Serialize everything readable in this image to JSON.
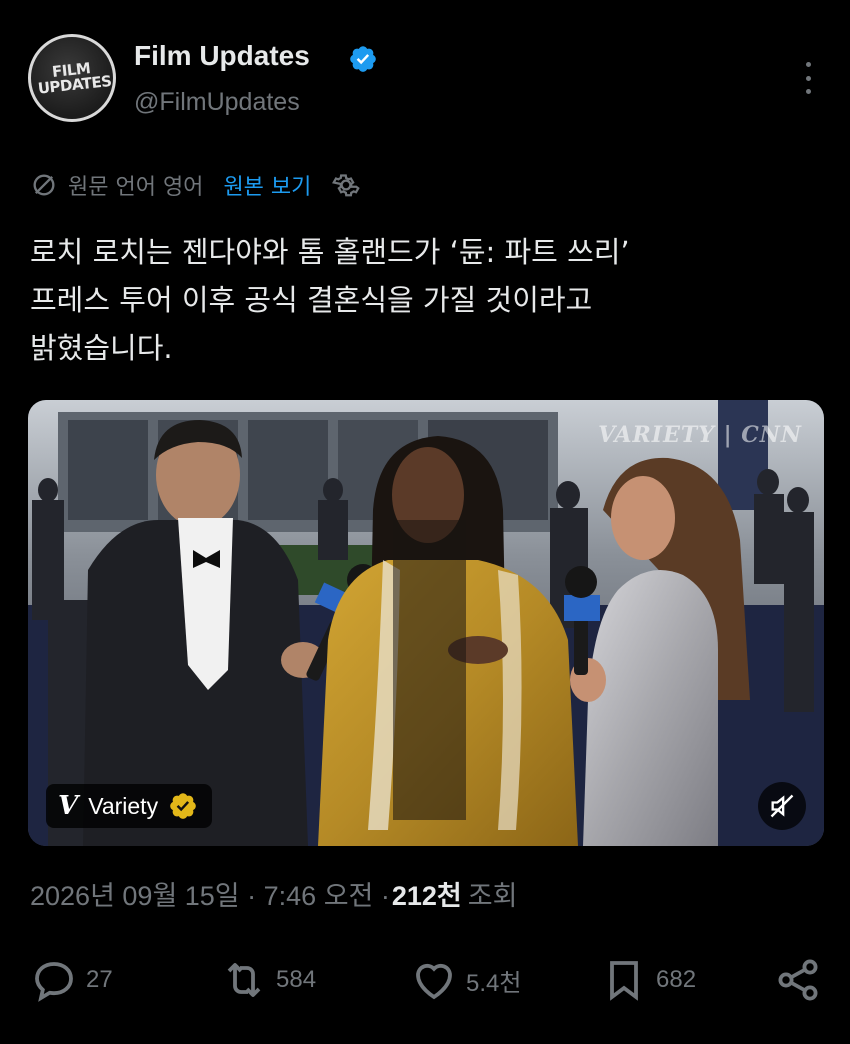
{
  "author": {
    "name": "Film Updates",
    "handle": "@FilmUpdates",
    "avatar_text": "FILM UPDATES",
    "verified_icon": "verified-badge-icon"
  },
  "translation": {
    "language_label": "원문 언어 영어",
    "show_original": "원본 보기"
  },
  "tweet": {
    "text": "로치 로치는 젠다야와 톰 홀랜드가 ‘듄: 파트 쓰리’\n프레스 투어 이후 공식 결혼식을 가질 것이라고\n밝혔습니다."
  },
  "media": {
    "source_name": "Variety",
    "watermark": "VARIETY | CNN",
    "colors": {
      "bg": "#2a2e3a",
      "carpet": "#1e2541",
      "gold_dress": "#b58a26",
      "silver_dress": "#b4b4b8",
      "suit": "#1e1f24"
    }
  },
  "meta": {
    "datetime": "2026년 09월 15일 · 7:46 오전 ·",
    "views": "212천",
    "views_label": "조회"
  },
  "actions": {
    "replies": "27",
    "reposts": "584",
    "likes": "5.4천",
    "bookmarks": "682"
  },
  "colors": {
    "accent": "#1d9bf0",
    "muted": "#71767b",
    "text": "#e7e9ea",
    "verified": "#1d9bf0",
    "gold_badge": "#e2b719"
  }
}
